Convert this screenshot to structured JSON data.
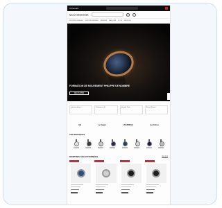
{
  "topbar": {
    "text": "Chrono24",
    "flag_color": "#c81e2b"
  },
  "header": {
    "logo": "MAJORDOME"
  },
  "nav": [
    "MONTRES HOMMES",
    "MONTRES FEMMES",
    "PREMIUM",
    "MARQUES",
    "BLOG",
    "SERVICES"
  ],
  "hero": {
    "title": "FORMATION DE MOUVEMENT PHILIPPE DE NOMBRE",
    "cta": "DÉCOUVRIR"
  },
  "promos": [
    "Livraison offerte",
    "Paiement en 3x",
    "Garantie 2 ans",
    "Retour 30 jours"
  ],
  "press": [
    "GQ",
    "Le Figaro",
    "L'EXPRESS",
    "Les Echos"
  ],
  "top_section": {
    "title": "TOP MARQUES"
  },
  "mini_watches": [
    {
      "face": "#e4e4e4"
    },
    {
      "face": "#3a3a3a"
    },
    {
      "face": "#c8c8c8"
    },
    {
      "face": "#1e2a44"
    },
    {
      "face": "#2b3f6b"
    },
    {
      "face": "#d6d6d6"
    },
    {
      "face": "#15203a"
    },
    {
      "face": "#bfbfbf"
    }
  ],
  "products_section": {
    "title": "MONTRES SÉLECTIONNÉES",
    "link": "Voir tout"
  },
  "products": [
    {
      "face": "#2b4a86",
      "accent": "#d3243a"
    },
    {
      "face": "#cfcfcf",
      "accent": "#d3243a"
    },
    {
      "face": "#1a1a1a",
      "accent": "#d3243a"
    },
    {
      "face": "#222222",
      "accent": "#d3243a"
    }
  ]
}
